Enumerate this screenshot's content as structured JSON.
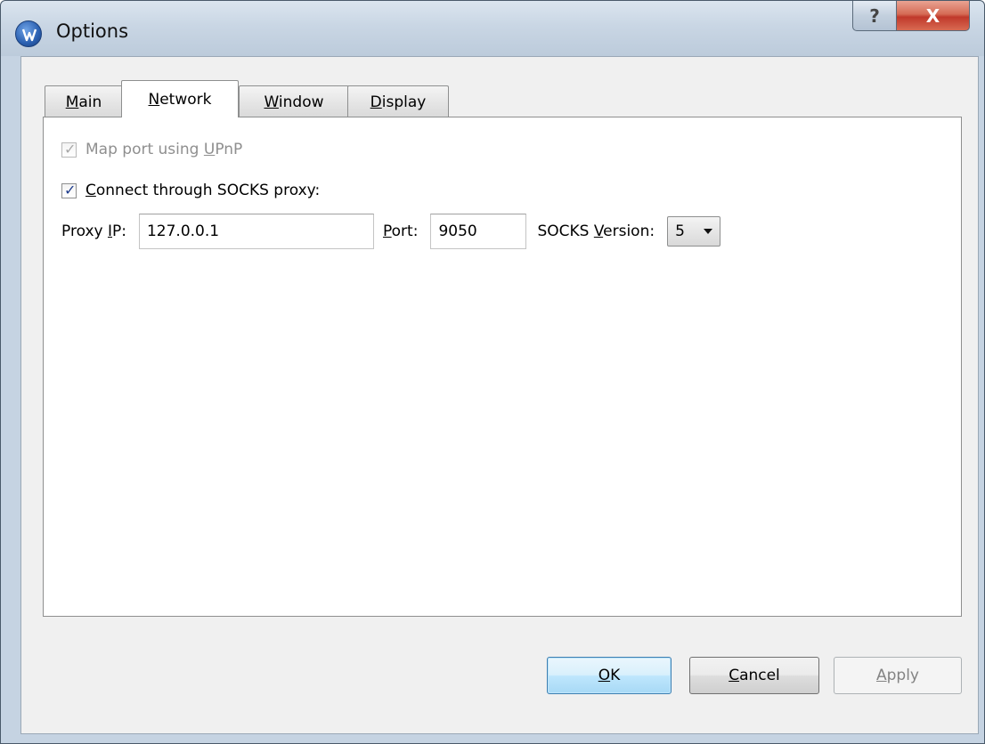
{
  "window": {
    "title": "Options",
    "help_glyph": "?",
    "close_glyph": "X"
  },
  "tabs": [
    {
      "pre": "",
      "mn": "M",
      "post": "ain",
      "active": false
    },
    {
      "pre": "",
      "mn": "N",
      "post": "etwork",
      "active": true
    },
    {
      "pre": "",
      "mn": "W",
      "post": "indow",
      "active": false
    },
    {
      "pre": "",
      "mn": "D",
      "post": "isplay",
      "active": false
    }
  ],
  "network": {
    "upnp": {
      "pre": "Map port using ",
      "mn": "U",
      "post": "PnP",
      "checked": true,
      "enabled": false
    },
    "socks": {
      "pre": "",
      "mn": "C",
      "post": "onnect through SOCKS proxy:",
      "checked": true,
      "enabled": true
    },
    "proxy_ip": {
      "pre": "Proxy ",
      "mn": "I",
      "post": "P:",
      "value": "127.0.0.1"
    },
    "port": {
      "pre": "",
      "mn": "P",
      "post": "ort:",
      "value": "9050"
    },
    "socks_version": {
      "pre": "SOCKS ",
      "mn": "V",
      "post": "ersion:",
      "selected": "5"
    }
  },
  "buttons": {
    "ok": {
      "pre": "",
      "mn": "O",
      "post": "K"
    },
    "cancel": {
      "pre": "",
      "mn": "C",
      "post": "ancel"
    },
    "apply": {
      "pre": "",
      "mn": "A",
      "post": "pply"
    }
  },
  "colors": {
    "check_tick": "#1e3c8c",
    "close_button": "#c0392b",
    "default_button_border": "#3c7fb1"
  }
}
